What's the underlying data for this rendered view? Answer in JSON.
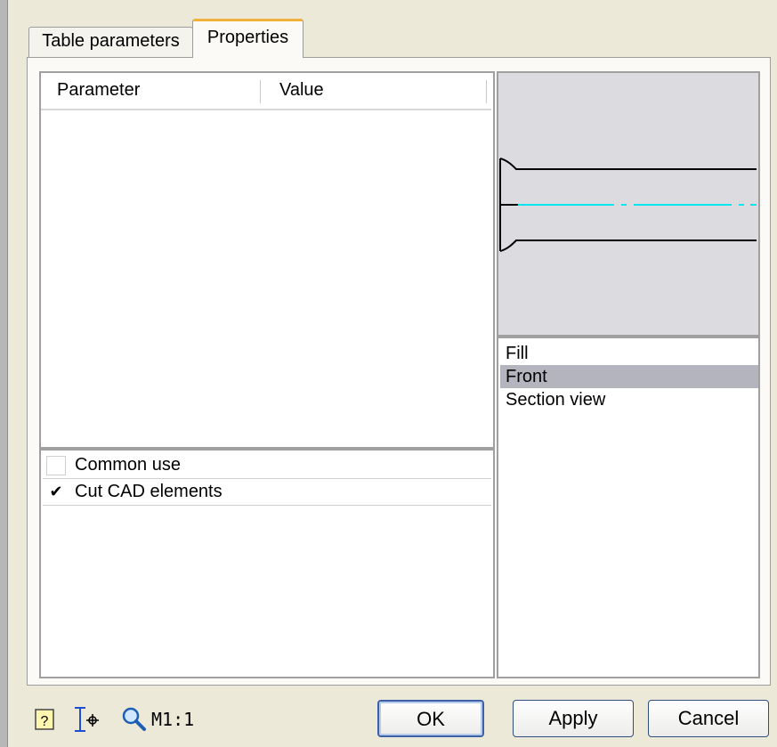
{
  "tabs": [
    {
      "label": "Table parameters",
      "active": false
    },
    {
      "label": "Properties",
      "active": true
    }
  ],
  "table": {
    "columns": [
      "Parameter",
      "Value"
    ],
    "rows": []
  },
  "options": [
    {
      "label": "Common use",
      "checked": false,
      "check_glyph": ""
    },
    {
      "label": "Cut CAD elements",
      "checked": true,
      "check_glyph": "✔"
    }
  ],
  "views": {
    "items": [
      "Fill",
      "Front",
      "Section view"
    ],
    "selected": "Front"
  },
  "preview": {
    "line_color": "#000000",
    "centerline_color": "#00e5ee"
  },
  "footer": {
    "zoom_label": "M1:1",
    "ok_label": "OK",
    "apply_label": "Apply",
    "cancel_label": "Cancel"
  },
  "icons": [
    "help-icon",
    "dimension-cursor-icon",
    "zoom-icon"
  ]
}
